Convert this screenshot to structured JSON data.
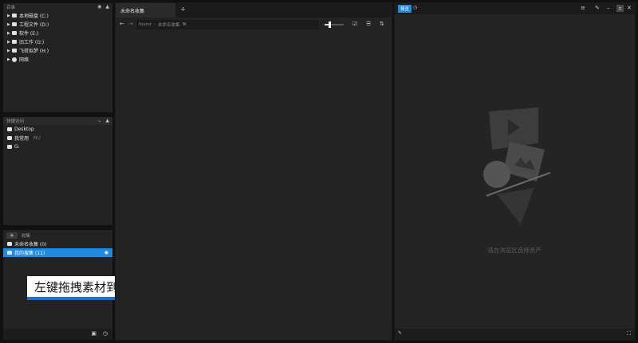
{
  "directory": {
    "title": "目录",
    "items": [
      {
        "label": "本地磁盘 (C:)"
      },
      {
        "label": "工程文件 (D:)"
      },
      {
        "label": "软件 (E:)"
      },
      {
        "label": "旧工作 (G:)"
      },
      {
        "label": "飞荷拟梦 (H:)"
      },
      {
        "label": "网络"
      }
    ]
  },
  "quick_access": {
    "title": "快捷访问",
    "items": [
      {
        "label": "Desktop",
        "note": ""
      },
      {
        "label": "我常用",
        "note": "H:/"
      },
      {
        "label": "G:",
        "note": ""
      }
    ]
  },
  "collections": {
    "add_label": "+",
    "title": "收集",
    "items": [
      {
        "label": "未命名收集 (0)"
      },
      {
        "label": "我的搜集 (11)"
      }
    ]
  },
  "tooltip": "左键拖拽素材到收藏",
  "browser": {
    "tab_label": "未命名收集",
    "new_tab": "+",
    "path_root": "found",
    "path_sep": "›",
    "path_current": "未命名收集",
    "path_suffix": "⌘"
  },
  "preview": {
    "tab_label": "预览",
    "empty_message": "请在浏览区选择资产"
  },
  "colors": {
    "accent": "#1e8be0",
    "panel": "#232323",
    "background": "#111111"
  }
}
